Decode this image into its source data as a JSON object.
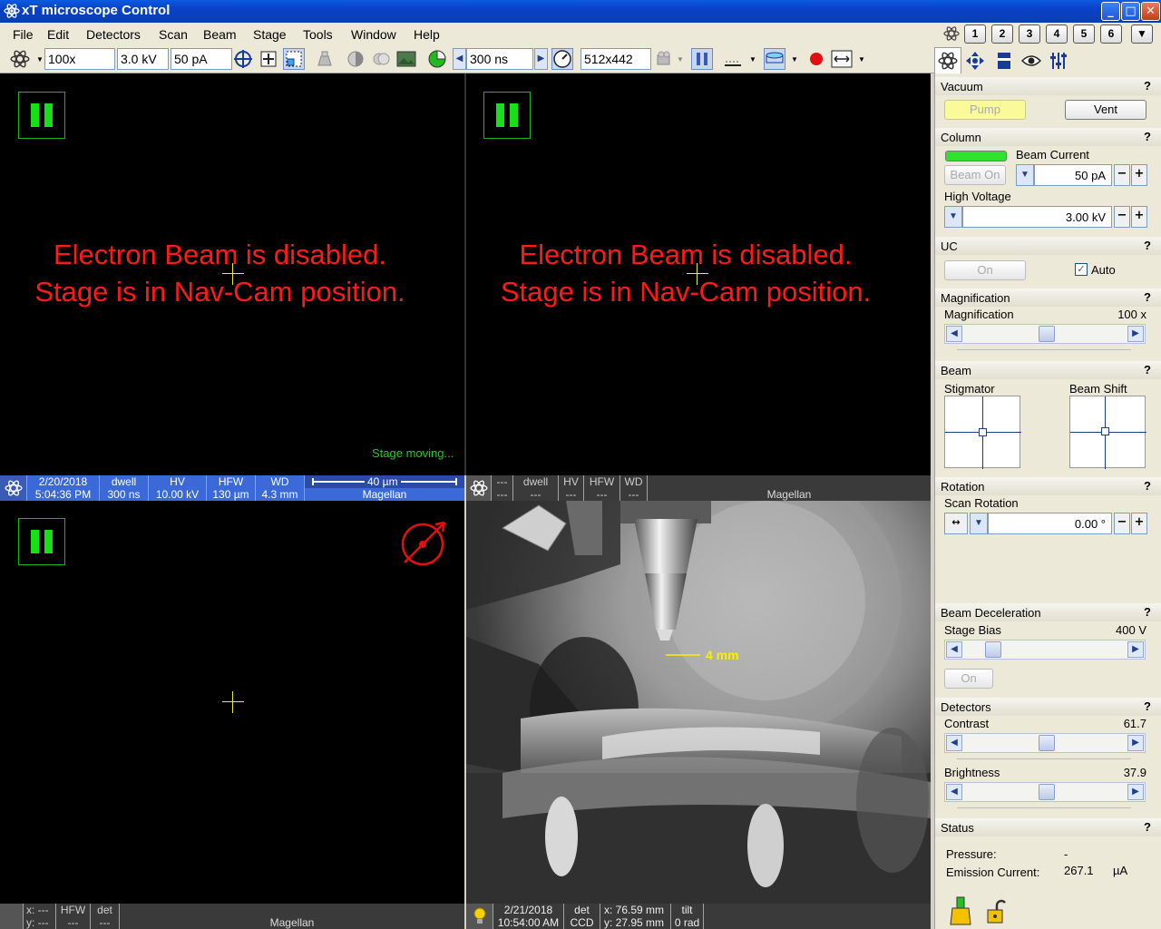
{
  "window": {
    "title": "xT microscope Control",
    "min": "_",
    "max": "□",
    "close": "✕"
  },
  "menu": [
    "File",
    "Edit",
    "Detectors",
    "Scan",
    "Beam",
    "Stage",
    "Tools",
    "Window",
    "Help"
  ],
  "presets": [
    "1",
    "2",
    "3",
    "4",
    "5",
    "6"
  ],
  "toolbar": {
    "magnification": "100x",
    "voltage": "3.0 kV",
    "current": "50 pA",
    "dwell": "300 ns",
    "resolution": "512x442"
  },
  "quads": {
    "q1": {
      "line1": "Electron Beam is disabled.",
      "line2": "Stage is in Nav-Cam position.",
      "status": "Stage moving..."
    },
    "q2": {
      "line1": "Electron Beam is disabled.",
      "line2": "Stage is in Nav-Cam position."
    },
    "q4": {
      "scale": "4 mm"
    }
  },
  "databar1": {
    "date": "2/20/2018",
    "time": "5:04:36 PM",
    "dwell_label": "dwell",
    "dwell": "300 ns",
    "hv_label": "HV",
    "hv": "10.00 kV",
    "hfw_label": "HFW",
    "hfw": "130 µm",
    "wd_label": "WD",
    "wd": "4.3 mm",
    "scale": "40 µm",
    "name": "Magellan"
  },
  "databar2": {
    "a1": "---",
    "a2": "---",
    "dwell_label": "dwell",
    "dwell": "---",
    "hv_label": "HV",
    "hv": "---",
    "hfw_label": "HFW",
    "hfw": "---",
    "wd_label": "WD",
    "wd": "---",
    "name": "Magellan"
  },
  "databar3": {
    "x_label": "x: ---",
    "y_label": "y: ---",
    "hfw_label": "HFW",
    "hfw": "---",
    "det_label": "det",
    "det": "---",
    "name": "Magellan"
  },
  "databar4": {
    "date": "2/21/2018",
    "time": "10:54:00 AM",
    "det_label": "det",
    "det": "CCD",
    "x": "x: 76.59 mm",
    "y": "y: 27.95 mm",
    "tilt_label": "tilt",
    "tilt": "0 rad"
  },
  "panel": {
    "vacuum": {
      "title": "Vacuum",
      "pump": "Pump",
      "vent": "Vent"
    },
    "column": {
      "title": "Column",
      "beam_current_label": "Beam Current",
      "beam_on": "Beam On",
      "beam_current": "50 pA",
      "hv_label": "High Voltage",
      "hv": "3.00 kV"
    },
    "uc": {
      "title": "UC",
      "on": "On",
      "auto": "Auto"
    },
    "magnification": {
      "title": "Magnification",
      "label": "Magnification",
      "value": "100 x",
      "position": 0.52
    },
    "beam": {
      "title": "Beam",
      "stigmator": "Stigmator",
      "shift": "Beam Shift"
    },
    "rotation": {
      "title": "Rotation",
      "label": "Scan Rotation",
      "value": "0.00 °"
    },
    "decel": {
      "title": "Beam Deceleration",
      "label": "Stage Bias",
      "value": "400 V",
      "on": "On",
      "position": 0.15
    },
    "detectors": {
      "title": "Detectors",
      "contrast_label": "Contrast",
      "contrast": "61.7",
      "contrast_pos": 0.52,
      "brightness_label": "Brightness",
      "brightness": "37.9",
      "brightness_pos": 0.52
    },
    "status": {
      "title": "Status",
      "pressure_label": "Pressure:",
      "pressure": "-",
      "emission_label": "Emission Current:",
      "emission": "267.1",
      "emission_unit": "µA"
    },
    "q": "?",
    "minus": "−",
    "plus": "+"
  }
}
